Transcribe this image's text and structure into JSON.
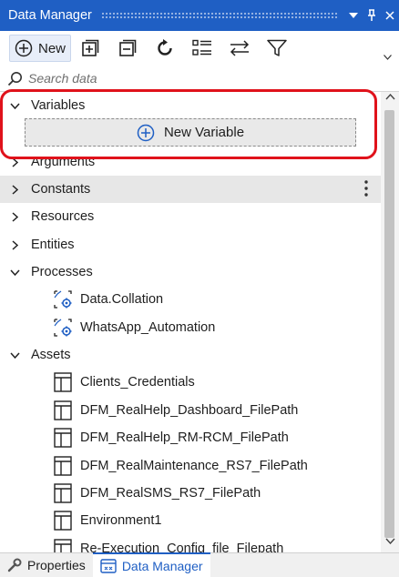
{
  "panel": {
    "title": "Data Manager",
    "icons": [
      "dropdown-arrow-icon",
      "pin-icon",
      "close-icon"
    ]
  },
  "toolbar": {
    "new_label": "New",
    "buttons": [
      "expand-all-icon",
      "collapse-all-icon",
      "refresh-icon",
      "list-view-icon",
      "swap-icon",
      "filter-icon"
    ]
  },
  "search": {
    "placeholder": "Search data"
  },
  "tree": {
    "variables": {
      "label": "Variables",
      "expanded": true,
      "new_variable_label": "New Variable"
    },
    "arguments": {
      "label": "Arguments",
      "expanded": false
    },
    "constants": {
      "label": "Constants",
      "expanded": false
    },
    "resources": {
      "label": "Resources",
      "expanded": false
    },
    "entities": {
      "label": "Entities",
      "expanded": false
    },
    "processes": {
      "label": "Processes",
      "expanded": true,
      "items": [
        "Data.Collation",
        "WhatsApp_Automation"
      ]
    },
    "assets": {
      "label": "Assets",
      "expanded": true,
      "items": [
        "Clients_Credentials",
        "DFM_RealHelp_Dashboard_FilePath",
        "DFM_RealHelp_RM-RCM_FilePath",
        "DFM_RealMaintenance_RS7_FilePath",
        "DFM_RealSMS_RS7_FilePath",
        "Environment1",
        "Re-Execution_Config_file_Filepath"
      ]
    }
  },
  "bottom_tabs": [
    {
      "label": "Properties",
      "active": false
    },
    {
      "label": "Data Manager",
      "active": true
    }
  ],
  "colors": {
    "accent": "#1f5fc4",
    "highlight_outline": "#e0121b"
  }
}
